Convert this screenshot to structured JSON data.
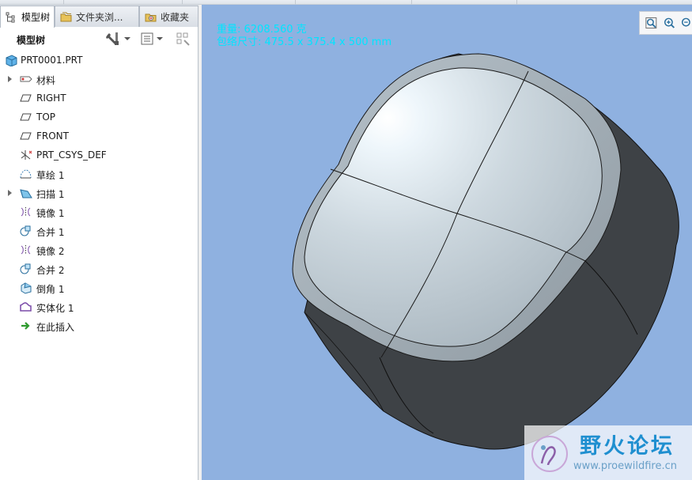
{
  "tabs": [
    {
      "label": "模型树"
    },
    {
      "label": "文件夹浏..."
    },
    {
      "label": "收藏夹"
    }
  ],
  "toolbar": {
    "title": "模型树"
  },
  "tree": {
    "root": "PRT0001.PRT",
    "items": [
      {
        "label": "材料",
        "icon": "material-icon"
      },
      {
        "label": "RIGHT",
        "icon": "datum-plane-icon"
      },
      {
        "label": "TOP",
        "icon": "datum-plane-icon"
      },
      {
        "label": "FRONT",
        "icon": "datum-plane-icon"
      },
      {
        "label": "PRT_CSYS_DEF",
        "icon": "csys-icon"
      },
      {
        "label": "草绘 1",
        "icon": "sketch-icon"
      },
      {
        "label": "扫描 1",
        "icon": "sweep-icon"
      },
      {
        "label": "镜像 1",
        "icon": "mirror-icon"
      },
      {
        "label": "合并 1",
        "icon": "merge-icon"
      },
      {
        "label": "镜像 2",
        "icon": "mirror-icon"
      },
      {
        "label": "合并 2",
        "icon": "merge-icon"
      },
      {
        "label": "倒角 1",
        "icon": "chamfer-icon"
      },
      {
        "label": "实体化 1",
        "icon": "solidify-icon"
      },
      {
        "label": "在此插入",
        "icon": "insert-here-icon"
      }
    ]
  },
  "viewport": {
    "info_line1": "重量: 6208.560 克",
    "info_line2": "包络尺寸: 475.5 x 375.4 x 500 mm",
    "background": "#8fb1e0"
  },
  "watermark": {
    "title": "野火论坛",
    "url": "www.proewildfire.cn"
  }
}
